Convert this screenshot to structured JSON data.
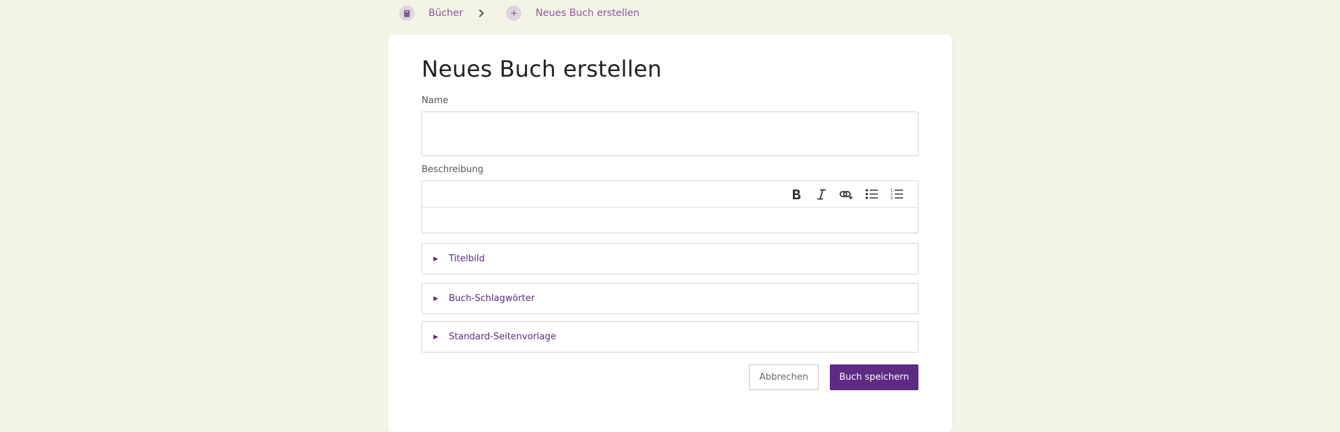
{
  "breadcrumb": {
    "items": [
      {
        "label": "Bücher",
        "icon": "book-icon"
      },
      {
        "label": "Neues Buch erstellen",
        "icon": "plus-icon"
      }
    ]
  },
  "form": {
    "title": "Neues Buch erstellen",
    "name_label": "Name",
    "name_value": "",
    "description_label": "Beschreibung",
    "toolbar": [
      "bold-icon",
      "italic-icon",
      "link-icon",
      "bullet-list-icon",
      "numbered-list-icon"
    ],
    "sections": [
      {
        "label": "Titelbild"
      },
      {
        "label": "Buch-Schlagwörter"
      },
      {
        "label": "Standard-Seitenvorlage"
      }
    ],
    "cancel_label": "Abbrechen",
    "save_label": "Buch speichern"
  },
  "colors": {
    "accent": "#5e2a84",
    "background": "#f4f4e6"
  }
}
